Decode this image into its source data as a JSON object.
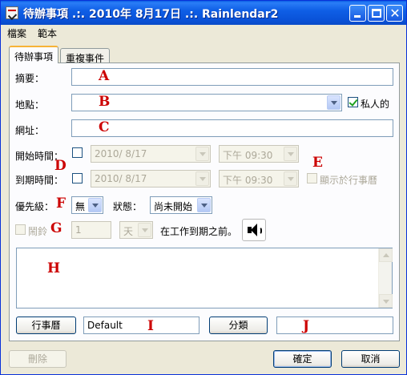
{
  "window": {
    "title": "待辦事項 .:. 2010年 8月17日 .:. Rainlendar2"
  },
  "menu": {
    "file": "檔案",
    "sample": "範本"
  },
  "tabs": [
    {
      "label": "待辦事項"
    },
    {
      "label": "重複事件"
    }
  ],
  "form": {
    "summary_label": "摘要：",
    "location_label": "地點：",
    "private_label": "私人的",
    "url_label": "網址：",
    "start_label": "開始時間：",
    "start_date": "2010/  8/17",
    "start_time": "下午 09:30",
    "due_label": "到期時間：",
    "due_date": "2010/  8/17",
    "due_time": "下午 09:30",
    "show_in_calendar_label": "顯示於行事曆",
    "priority_label": "優先級：",
    "priority_value": "無",
    "status_label": "狀態：",
    "status_value": "尚未開始",
    "alarm_label": "鬧鈴",
    "alarm_amount": "1",
    "alarm_unit": "天",
    "alarm_suffix": "在工作到期之前。",
    "calendar_button": "行事曆",
    "calendar_value": "Default",
    "category_button": "分類",
    "category_value": ""
  },
  "markers": {
    "a": "A",
    "b": "B",
    "c": "C",
    "d": "D",
    "e": "E",
    "f": "F",
    "g": "G",
    "h": "H",
    "i": "I",
    "j": "J"
  },
  "footer": {
    "delete_label": "刪除",
    "ok_label": "確定",
    "cancel_label": "取消"
  },
  "icons": {
    "app": "rainlendar-app-icon",
    "speaker": "speaker-icon",
    "minimize": "minimize-icon",
    "maximize": "maximize-icon",
    "close": "close-icon"
  },
  "colors": {
    "titlebar": "#0a52d8",
    "marker": "#cc0000",
    "window_bg": "#ece9d8"
  }
}
